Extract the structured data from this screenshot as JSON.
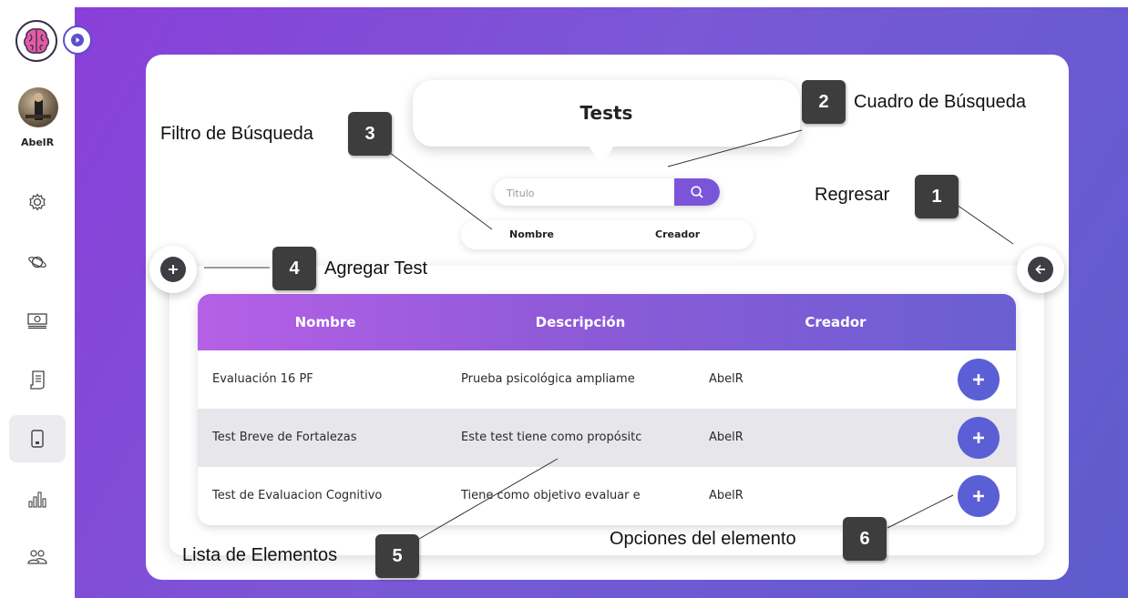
{
  "sidebar": {
    "user_name": "AbelR",
    "items": [
      {
        "icon": "gear-icon"
      },
      {
        "icon": "planet-icon"
      },
      {
        "icon": "money-icon"
      },
      {
        "icon": "document-icon"
      },
      {
        "icon": "tablet-icon"
      },
      {
        "icon": "bar-chart-icon"
      },
      {
        "icon": "users-icon"
      }
    ]
  },
  "header": {
    "title": "Tests"
  },
  "search": {
    "placeholder": "Titulo"
  },
  "filter": {
    "options": [
      "Nombre",
      "Creador"
    ]
  },
  "table": {
    "columns": [
      "Nombre",
      "Descripción",
      "Creador"
    ],
    "rows": [
      {
        "name": "Evaluación 16 PF",
        "description": "Prueba psicológica ampliame",
        "creator": "AbelR"
      },
      {
        "name": "Test Breve de Fortalezas",
        "description": "Este test tiene como propósitc",
        "creator": "AbelR"
      },
      {
        "name": "Test de Evaluacion Cognitivo",
        "description": "Tiene como objetivo evaluar e",
        "creator": "AbelR"
      }
    ]
  },
  "annotations": [
    {
      "number": "1",
      "label": "Regresar"
    },
    {
      "number": "2",
      "label": "Cuadro de Búsqueda"
    },
    {
      "number": "3",
      "label": "Filtro de Búsqueda"
    },
    {
      "number": "4",
      "label": "Agregar Test"
    },
    {
      "number": "5",
      "label": "Lista de Elementos"
    },
    {
      "number": "6",
      "label": "Opciones del elemento"
    }
  ],
  "colors": {
    "accent": "#7b55d9",
    "row_button": "#5a5fd6",
    "background_gradient_start": "#8a3fd8",
    "background_gradient_end": "#5d5ccd",
    "badge": "#3d3d3d"
  }
}
